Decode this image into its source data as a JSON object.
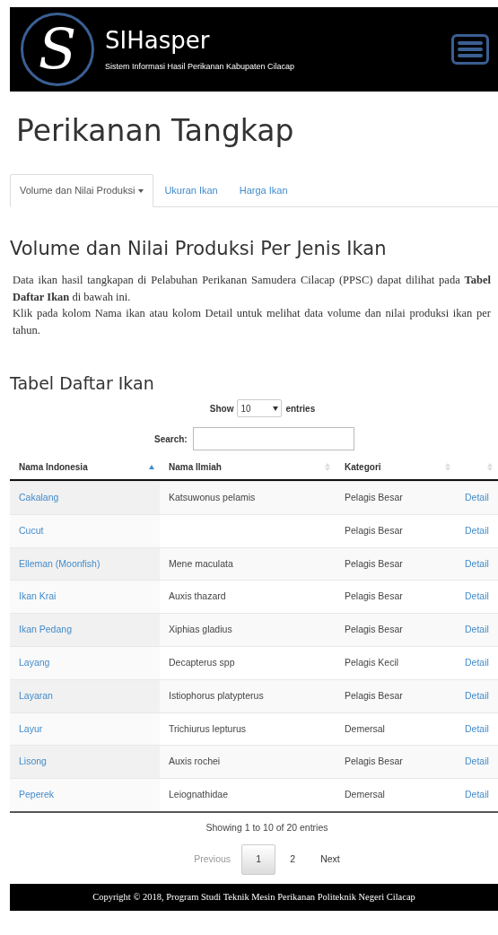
{
  "header": {
    "logo_letter": "S",
    "title": "SIHasper",
    "subtitle": "Sistem Informasi Hasil Perikanan Kabupaten Cilacap"
  },
  "page_title": "Perikanan Tangkap",
  "tabs": [
    {
      "label": "Volume dan Nilai Produksi",
      "dropdown": true,
      "selected": true
    },
    {
      "label": "Ukuran Ikan",
      "dropdown": false,
      "selected": false
    },
    {
      "label": "Harga Ikan",
      "dropdown": false,
      "selected": false
    }
  ],
  "section_title": "Volume dan Nilai Produksi Per Jenis Ikan",
  "paragraphs": [
    "Data ikan hasil tangkapan di  Pelabuhan Perikanan Samudera Cilacap (PPSC)  dapat dilihat pada **Tabel  Daftar  Ikan** di bawah ini.",
    "Klik pada kolom Nama ikan atau kolom  Detail untuk melihat data volume dan nilai produksi ikan per tahun."
  ],
  "table": {
    "title": "Tabel Daftar Ikan",
    "length": {
      "before": "Show",
      "value": "10",
      "after": "entries"
    },
    "search": {
      "label": "Search:"
    },
    "columns": [
      {
        "label": "Nama Indonesia",
        "sorted": true
      },
      {
        "label": "Nama Ilmiah",
        "sorted": false
      },
      {
        "label": "Kategori",
        "sorted": false
      },
      {
        "sorted": false
      }
    ],
    "rows": [
      [
        "Cakalang",
        "Katsuwonus pelamis",
        "Pelagis Besar",
        "Detail"
      ],
      [
        "Cucut",
        "",
        "Pelagis Besar",
        "Detail"
      ],
      [
        "Elleman (Moonfish)",
        "Mene maculata",
        "Pelagis Besar",
        "Detail"
      ],
      [
        "Ikan Krai",
        "Auxis thazard",
        "Pelagis Besar",
        "Detail"
      ],
      [
        "Ikan Pedang",
        "Xiphias gladius",
        "Pelagis Besar",
        "Detail"
      ],
      [
        "Layang",
        "Decapterus spp",
        "Pelagis Kecil",
        "Detail"
      ],
      [
        "Layaran",
        "Istiophorus platypterus",
        "Pelagis Besar",
        "Detail"
      ],
      [
        "Layur",
        "Trichiurus lepturus",
        "Demersal",
        "Detail"
      ],
      [
        "Lisong",
        "Auxis rochei",
        "Pelagis Besar",
        "Detail"
      ],
      [
        "Peperek",
        "Leiognathidae",
        "Demersal",
        "Detail"
      ]
    ],
    "info": "Showing 1 to 10 of 20 entries",
    "pagination": {
      "previous": {
        "label": "Previous",
        "disabled": true
      },
      "pages": [
        {
          "label": "1",
          "selected": true
        },
        {
          "label": "2",
          "selected": false
        }
      ],
      "next": {
        "label": "Next",
        "disabled": false
      }
    }
  },
  "footer": "Copyright © 2018, Program Studi Teknik Mesin Perikanan Politeknik Negeri Cilacap"
}
